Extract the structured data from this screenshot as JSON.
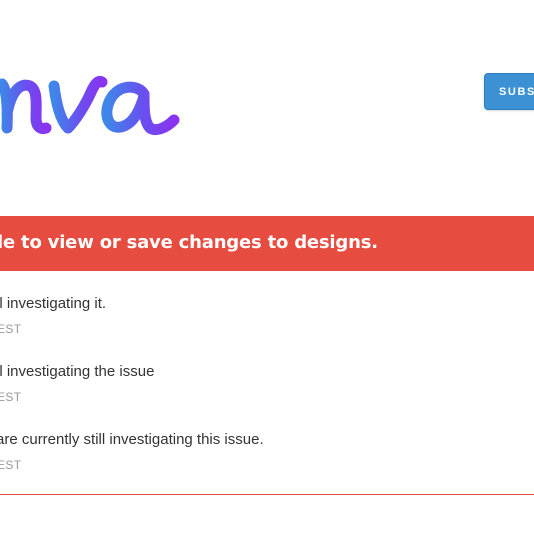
{
  "header": {
    "logo_alt": "Canva",
    "subscribe_label": "SUBSCRIBE"
  },
  "incident": {
    "title": "le to view or save changes to designs."
  },
  "updates": [
    {
      "body": "ll investigating it.",
      "time": "EST"
    },
    {
      "body": "ll investigating the issue",
      "time": "EST"
    },
    {
      "body": "are currently still investigating this issue.",
      "time": "EST"
    }
  ],
  "colors": {
    "banner": "#e64c3f",
    "button": "#3b91d4",
    "logo_start": "#3f86e8",
    "logo_end": "#8a33f0"
  }
}
